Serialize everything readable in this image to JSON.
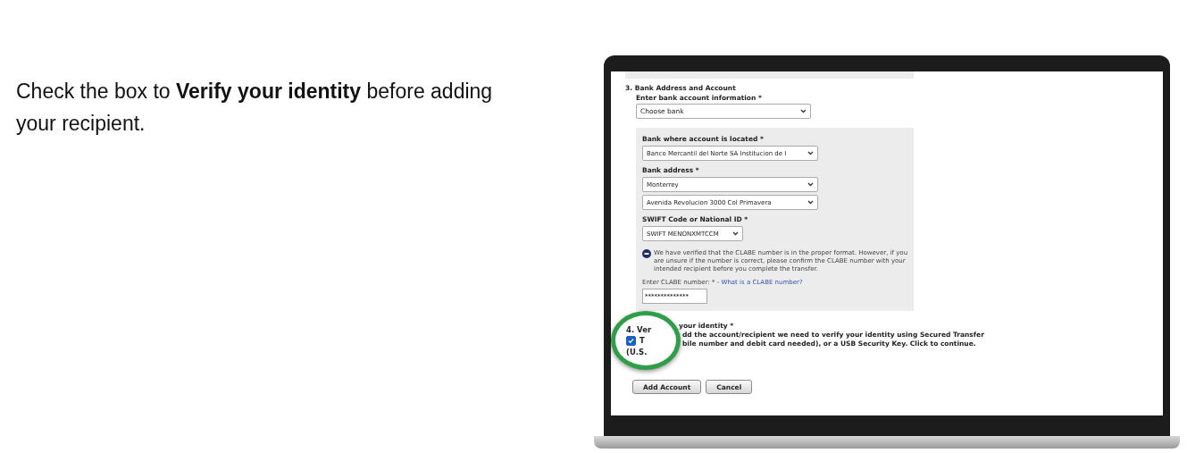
{
  "intro": {
    "text": "Check the box to **Verify your identity** before adding your recipient."
  },
  "form": {
    "section_3": {
      "title": "3. Bank Address and Account",
      "label": "Enter bank account information *",
      "select": "Choose bank"
    },
    "bank_panel": {
      "fields": [
        {
          "kind": "select",
          "label": "Bank where account is located *",
          "value": "Banco Mercantil del Norte SA Institucion de I"
        },
        {
          "kind": "select",
          "label": "Bank address *",
          "value": "Monterrey"
        },
        {
          "kind": "select",
          "value": "Avenida Revolucion 3000 Col Primavera"
        },
        {
          "kind": "short_select",
          "label": "SWIFT Code or National ID *",
          "value": "SWIFT MENONXMTCCM"
        }
      ],
      "notice": "We have verified that the CLABE number is in the proper format. However, if you are unsure if the number is correct, please confirm the CLABE number with your intended recipient before you complete the transfer.",
      "clabe": {
        "label": "Enter CLABE number: * - ",
        "link": "What is a CLABE number?",
        "value": "**************"
      }
    },
    "section_4": {
      "magnified": {
        "title": "4. Ver",
        "line_1": "T",
        "line_2": "(U.S."
      },
      "title": "your identity *",
      "line_1": "dd the account/recipient we need to verify your identity using Secured Transfer",
      "line_2": "bile number and debit card needed), or a USB Security Key. Click to continue.",
      "checked": true
    },
    "buttons": [
      "Add Account",
      "Cancel"
    ]
  }
}
